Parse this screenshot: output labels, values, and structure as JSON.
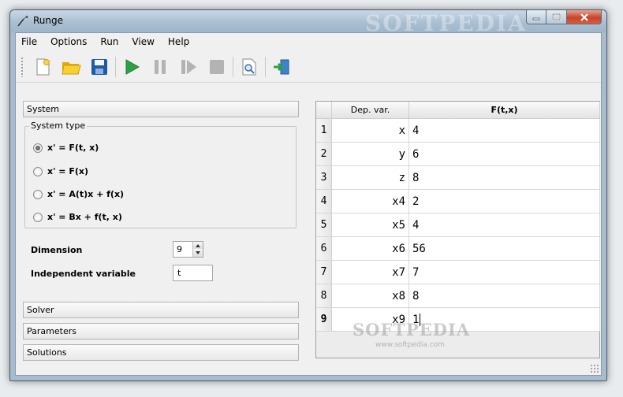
{
  "window": {
    "title": "Runge",
    "watermark": "SOFTPEDIA",
    "watermark_url": "www.softpedia.com"
  },
  "menu": [
    "File",
    "Options",
    "Run",
    "View",
    "Help"
  ],
  "toolbar": {
    "icons": [
      "new-document-icon",
      "open-folder-icon",
      "save-icon",
      "run-icon",
      "pause-icon",
      "step-icon",
      "stop-icon",
      "preview-icon",
      "exit-icon"
    ]
  },
  "left_panel": {
    "sections": {
      "system": "System",
      "solver": "Solver",
      "parameters": "Parameters",
      "solutions": "Solutions"
    },
    "system_type": {
      "title": "System type",
      "options": [
        "x' = F(t, x)",
        "x' = F(x)",
        "x' = A(t)x + f(x)",
        "x' = Bx + f(t, x)"
      ],
      "selected": "x' = F(t, x)"
    },
    "dimension": {
      "label": "Dimension",
      "value": "9"
    },
    "independent_variable": {
      "label": "Independent variable",
      "value": "t"
    }
  },
  "table": {
    "headers": [
      "Dep. var.",
      "F(t,x)"
    ],
    "rows": [
      {
        "num": "1",
        "dep": "x",
        "f": "4"
      },
      {
        "num": "2",
        "dep": "y",
        "f": "6"
      },
      {
        "num": "3",
        "dep": "z",
        "f": "8"
      },
      {
        "num": "4",
        "dep": "x4",
        "f": "2"
      },
      {
        "num": "5",
        "dep": "x5",
        "f": "4"
      },
      {
        "num": "6",
        "dep": "x6",
        "f": "56"
      },
      {
        "num": "7",
        "dep": "x7",
        "f": "7"
      },
      {
        "num": "8",
        "dep": "x8",
        "f": "8"
      },
      {
        "num": "9",
        "dep": "x9",
        "f": "1"
      }
    ]
  },
  "colors": {
    "run_green": "#2ea043",
    "save_blue": "#1e5aa8",
    "folder_yellow": "#f2c418",
    "close_red": "#c7442a"
  }
}
